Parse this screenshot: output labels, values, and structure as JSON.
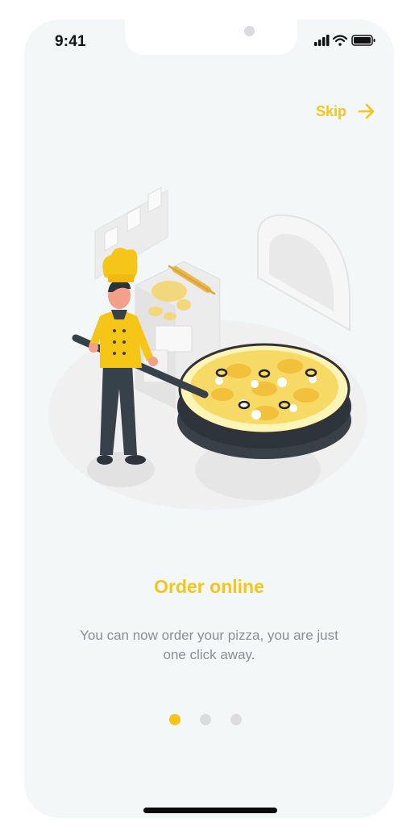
{
  "status_bar": {
    "time": "9:41"
  },
  "onboarding": {
    "skip_label": "Skip",
    "title": "Order online",
    "description": "You can now order your pizza, you are just one click away.",
    "pagination": {
      "total": 3,
      "active_index": 0
    }
  },
  "colors": {
    "accent": "#f5c518",
    "background": "#f4f7f7",
    "text_muted": "#8a8f96",
    "dot_inactive": "#dcdcdc"
  },
  "icons": {
    "skip": "arrow-right-icon",
    "signal": "cellular-signal-icon",
    "wifi": "wifi-icon",
    "battery": "battery-icon",
    "illustration": "chef-pizza-illustration"
  }
}
